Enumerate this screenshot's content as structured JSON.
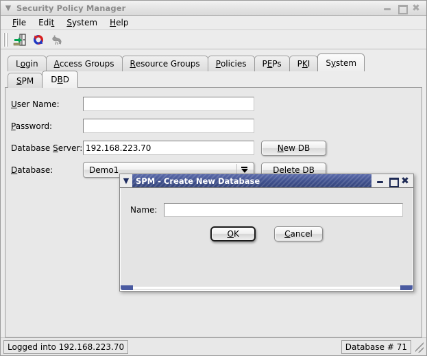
{
  "window": {
    "title": "Security Policy Manager",
    "menu_icon": "chevron-down-icon",
    "buttons": {
      "minimize": "–",
      "maximize": "□",
      "close": "✖"
    }
  },
  "menubar": {
    "items": [
      {
        "label": "File",
        "pre": "",
        "mn": "F",
        "post": "ile"
      },
      {
        "label": "Edit",
        "pre": "Edi",
        "mn": "t",
        "post": ""
      },
      {
        "label": "System",
        "pre": "",
        "mn": "S",
        "post": "ystem"
      },
      {
        "label": "Help",
        "pre": "",
        "mn": "H",
        "post": "elp"
      }
    ]
  },
  "toolbar": {
    "buttons": [
      {
        "name": "login-door-icon",
        "title": "Login"
      },
      {
        "name": "refresh-icon",
        "title": "Refresh"
      },
      {
        "name": "bird-icon",
        "title": "Agent"
      }
    ]
  },
  "tabs": {
    "main": [
      {
        "pre": "L",
        "mn": "o",
        "post": "gin",
        "active": false
      },
      {
        "pre": "",
        "mn": "A",
        "post": "ccess Groups",
        "active": false
      },
      {
        "pre": "",
        "mn": "R",
        "post": "esource Groups",
        "active": false
      },
      {
        "pre": "",
        "mn": "P",
        "post": "olicies",
        "active": false
      },
      {
        "pre": "P",
        "mn": "E",
        "post": "Ps",
        "active": false
      },
      {
        "pre": "P",
        "mn": "K",
        "post": "I",
        "active": false
      },
      {
        "pre": "S",
        "mn": "y",
        "post": "stem",
        "active": true
      }
    ],
    "sub": [
      {
        "pre": "",
        "mn": "S",
        "post": "PM",
        "active": false
      },
      {
        "pre": "D",
        "mn": "B",
        "post": "D",
        "active": true
      }
    ]
  },
  "form": {
    "user_name": {
      "pre": "",
      "mn": "U",
      "post": "ser Name:",
      "value": "",
      "placeholder": ""
    },
    "password": {
      "pre": "",
      "mn": "P",
      "post": "assword:",
      "value": "",
      "placeholder": ""
    },
    "db_server": {
      "pre": "Database ",
      "mn": "S",
      "post": "erver:",
      "value": "192.168.223.70",
      "placeholder": ""
    },
    "database": {
      "pre": "",
      "mn": "D",
      "post": "atabase:",
      "value": "Demo1"
    },
    "new_db": {
      "pre": "",
      "mn": "N",
      "post": "ew DB"
    },
    "delete_db": {
      "pre": "Delete D",
      "mn": "B",
      "post": ""
    }
  },
  "statusbar": {
    "left": "Logged into 192.168.223.70",
    "right": "Database # 71"
  },
  "dialog": {
    "title": "SPM - Create New Database",
    "menu_icon": "chevron-down-icon",
    "buttons": {
      "minimize": "–",
      "maximize": "□",
      "close": "✖"
    },
    "name_label": "Name:",
    "name_value": "",
    "name_placeholder": "",
    "ok": {
      "pre": "",
      "mn": "O",
      "post": "K"
    },
    "cancel": {
      "pre": "",
      "mn": "C",
      "post": "ancel"
    }
  },
  "colors": {
    "window_bg": "#e8e8e8",
    "dialog_title_blue": "#41528f",
    "dialog_grip_blue": "#4a5aa0",
    "field_white": "#ffffff",
    "border_gray": "#9c9c9c"
  }
}
